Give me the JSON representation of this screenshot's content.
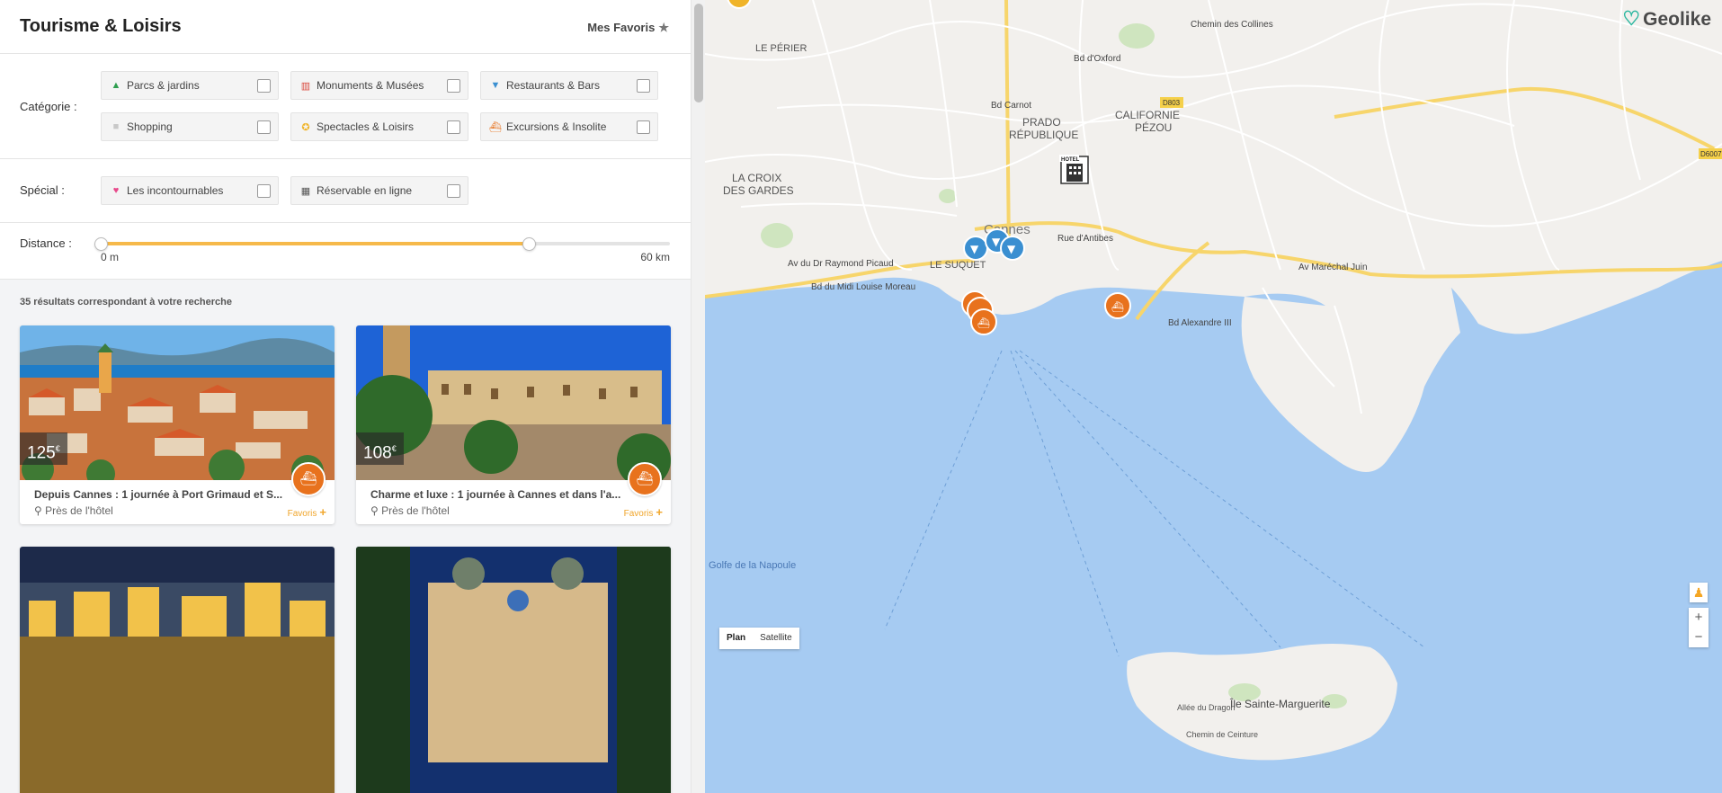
{
  "header": {
    "title": "Tourisme & Loisirs",
    "favorites_label": "Mes Favoris"
  },
  "filters": {
    "category_label": "Catégorie :",
    "categories": [
      {
        "label": "Parcs & jardins",
        "icon": "tree-icon",
        "color": "#2e9e4f"
      },
      {
        "label": "Monuments & Musées",
        "icon": "museum-icon",
        "color": "#d9473b"
      },
      {
        "label": "Restaurants & Bars",
        "icon": "cocktail-icon",
        "color": "#3a8fd1"
      },
      {
        "label": "Shopping",
        "icon": "cart-icon",
        "color": "#c8c8c8"
      },
      {
        "label": "Spectacles & Loisirs",
        "icon": "film-reel-icon",
        "color": "#f0b429"
      },
      {
        "label": "Excursions & Insolite",
        "icon": "boat-icon",
        "color": "#e8721d"
      }
    ],
    "special_label": "Spécial :",
    "special": [
      {
        "label": "Les incontournables",
        "icon": "heart-icon",
        "color": "#e8488a"
      },
      {
        "label": "Réservable en ligne",
        "icon": "calendar-icon",
        "color": "#555555"
      }
    ],
    "distance_label": "Distance :",
    "distance_min_label": "0 m",
    "distance_max_label": "60 km",
    "distance_selected_fraction": 0.752
  },
  "results": {
    "count_text": "35 résultats correspondant à votre recherche",
    "cards": [
      {
        "price": "125",
        "currency": "€",
        "title": "Depuis Cannes : 1 journée à Port Grimaud et S...",
        "location": "Près de l'hôtel",
        "favorite_label": "Favoris"
      },
      {
        "price": "108",
        "currency": "€",
        "title": "Charme et luxe : 1 journée à Cannes et dans l'a...",
        "location": "Près de l'hôtel",
        "favorite_label": "Favoris"
      },
      {
        "price": "",
        "currency": "",
        "title": "",
        "location": "",
        "favorite_label": ""
      },
      {
        "price": "",
        "currency": "",
        "title": "",
        "location": "",
        "favorite_label": ""
      }
    ]
  },
  "map": {
    "logo": "Geolike",
    "tabs": [
      "Plan",
      "Satellite"
    ],
    "active_tab": "Plan",
    "zoom_in": "+",
    "zoom_out": "−",
    "labels": [
      "LE PÉRIER",
      "PRADO",
      "RÉPUBLIQUE",
      "CALIFORNIE",
      "PÉZOU",
      "LA CROIX",
      "DES GARDES",
      "LE SUQUET",
      "Cannes",
      "Av du Dr Raymond Picaud",
      "Bd du Midi Louise Moreau",
      "Av Maréchal Juin",
      "Bd Alexandre III",
      "Rue d'Antibes",
      "Bd Carnot",
      "Bd d'Oxford",
      "Chemin des Collines",
      "Golfe de la Napoule",
      "Île Sainte-Marguerite",
      "Allée du Dragon",
      "Chemin de Ceinture",
      "D803",
      "D6007",
      "HOTEL"
    ]
  }
}
